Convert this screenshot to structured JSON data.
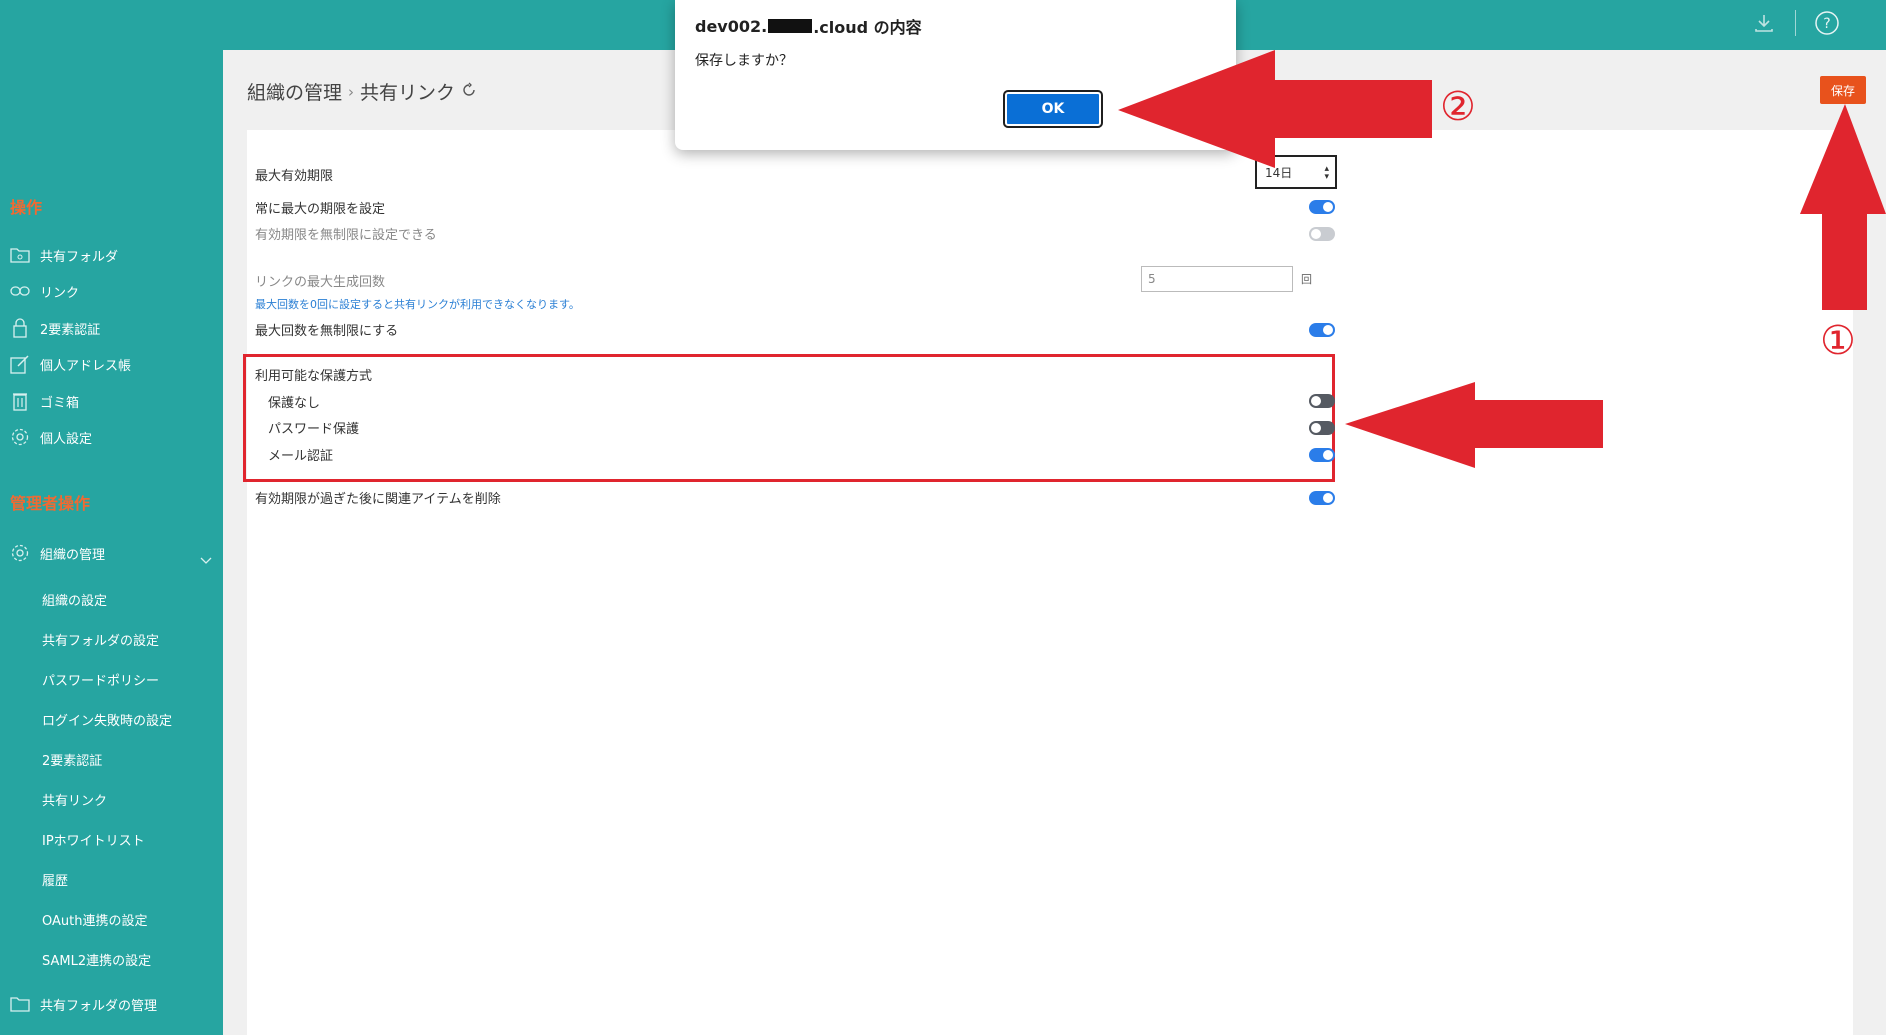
{
  "topbar": {
    "icons": [
      "download-icon",
      "help-icon"
    ]
  },
  "sidebar": {
    "operations_title": "操作",
    "operations": [
      {
        "label": "共有フォルダ",
        "icon": "folder-icon"
      },
      {
        "label": "リンク",
        "icon": "link-icon"
      },
      {
        "label": "2要素認証",
        "icon": "lock-icon"
      },
      {
        "label": "個人アドレス帳",
        "icon": "edit-icon"
      },
      {
        "label": "ゴミ箱",
        "icon": "trash-icon"
      },
      {
        "label": "個人設定",
        "icon": "gear-icon"
      }
    ],
    "admin_title": "管理者操作",
    "org_management": "組織の管理",
    "org_sub": [
      "組織の設定",
      "共有フォルダの設定",
      "パスワードポリシー",
      "ログイン失敗時の設定",
      "2要素認証",
      "共有リンク",
      "IPホワイトリスト",
      "履歴",
      "OAuth連携の設定",
      "SAML2連携の設定"
    ],
    "folder_management": "共有フォルダの管理"
  },
  "main": {
    "breadcrumb_parent": "組織の管理",
    "breadcrumb_sep": "›",
    "breadcrumb_current": "共有リンク",
    "save_label": "保存",
    "max_expiry_label": "最大有効期限",
    "max_expiry_value": "14日",
    "always_max_label": "常に最大の期限を設定",
    "unlimited_expiry_label": "有効期限を無制限に設定できる",
    "max_link_count_label": "リンクの最大生成回数",
    "max_link_count_value": "5",
    "max_link_count_unit": "回",
    "max_link_hint": "最大回数を0回に設定すると共有リンクが利用できなくなります。",
    "unlimited_count_label": "最大回数を無制限にする",
    "protection_title": "利用可能な保護方式",
    "protection_none": "保護なし",
    "protection_password": "パスワード保護",
    "protection_email": "メール認証",
    "delete_after_expiry_label": "有効期限が過ぎた後に関連アイテムを削除",
    "toggles": {
      "always_max": true,
      "unlimited_expiry": false,
      "unlimited_count": true,
      "protection_none": false,
      "protection_password": false,
      "protection_email": true,
      "delete_after_expiry": true
    }
  },
  "dialog": {
    "title_prefix": "dev002.",
    "title_suffix": ".cloud の内容",
    "message": "保存しますか？",
    "ok_label": "OK"
  },
  "annotations": {
    "step1": "①",
    "step2": "②",
    "color": "#e0252e"
  }
}
